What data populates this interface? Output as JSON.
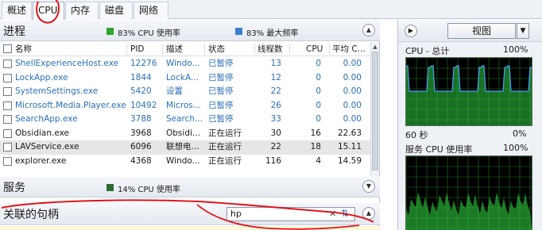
{
  "tabs": [
    "概述",
    "CPU",
    "内存",
    "磁盘",
    "网络"
  ],
  "active_tab": "CPU",
  "processes": {
    "title": "进程",
    "legend_cpu": "83% CPU 使用率",
    "legend_freq": "83% 最大频率",
    "legend_cpu_color": "#2fa52f",
    "legend_freq_color": "#3b7fd0",
    "columns": [
      "名称",
      "PID",
      "描述",
      "状态",
      "线程数",
      "CPU",
      "平均 C..."
    ],
    "rows": [
      {
        "name": "ShellExperienceHost.exe",
        "pid": "12276",
        "desc": "Windo...",
        "status": "已暂停",
        "threads": "13",
        "cpu": "0",
        "avg": "0.00",
        "suspended": true
      },
      {
        "name": "LockApp.exe",
        "pid": "1844",
        "desc": "LockA...",
        "status": "已暂停",
        "threads": "12",
        "cpu": "0",
        "avg": "0.00",
        "suspended": true
      },
      {
        "name": "SystemSettings.exe",
        "pid": "5420",
        "desc": "设置",
        "status": "已暂停",
        "threads": "22",
        "cpu": "0",
        "avg": "0.00",
        "suspended": true
      },
      {
        "name": "Microsoft.Media.Player.exe",
        "pid": "10492",
        "desc": "Micros...",
        "status": "已暂停",
        "threads": "26",
        "cpu": "0",
        "avg": "0.00",
        "suspended": true
      },
      {
        "name": "SearchApp.exe",
        "pid": "3788",
        "desc": "Search...",
        "status": "已暂停",
        "threads": "33",
        "cpu": "0",
        "avg": "0.00",
        "suspended": true
      },
      {
        "name": "Obsidian.exe",
        "pid": "3968",
        "desc": "Obsidi...",
        "status": "正在运行",
        "threads": "30",
        "cpu": "16",
        "avg": "22.63",
        "suspended": false
      },
      {
        "name": "LAVService.exe",
        "pid": "6096",
        "desc": "联想电...",
        "status": "正在运行",
        "threads": "22",
        "cpu": "18",
        "avg": "15.11",
        "suspended": false
      },
      {
        "name": "explorer.exe",
        "pid": "4368",
        "desc": "Windo...",
        "status": "正在运行",
        "threads": "116",
        "cpu": "4",
        "avg": "14.59",
        "suspended": false
      }
    ]
  },
  "services": {
    "title": "服务",
    "legend": "14% CPU 使用率",
    "legend_color": "#2d6b2d"
  },
  "handles": {
    "title": "关联的句柄",
    "search_value": "hp"
  },
  "right": {
    "view_label": "视图",
    "graph1_title": "CPU - 总计",
    "graph1_max": "100%",
    "graph1_time": "60 秒",
    "graph1_min": "0%",
    "graph2_title": "服务 CPU 使用率",
    "graph2_max": "100%",
    "grid_color": "#1f7a1f",
    "line_color": "#4aa0ff",
    "fill_color": "#2ecc40"
  }
}
